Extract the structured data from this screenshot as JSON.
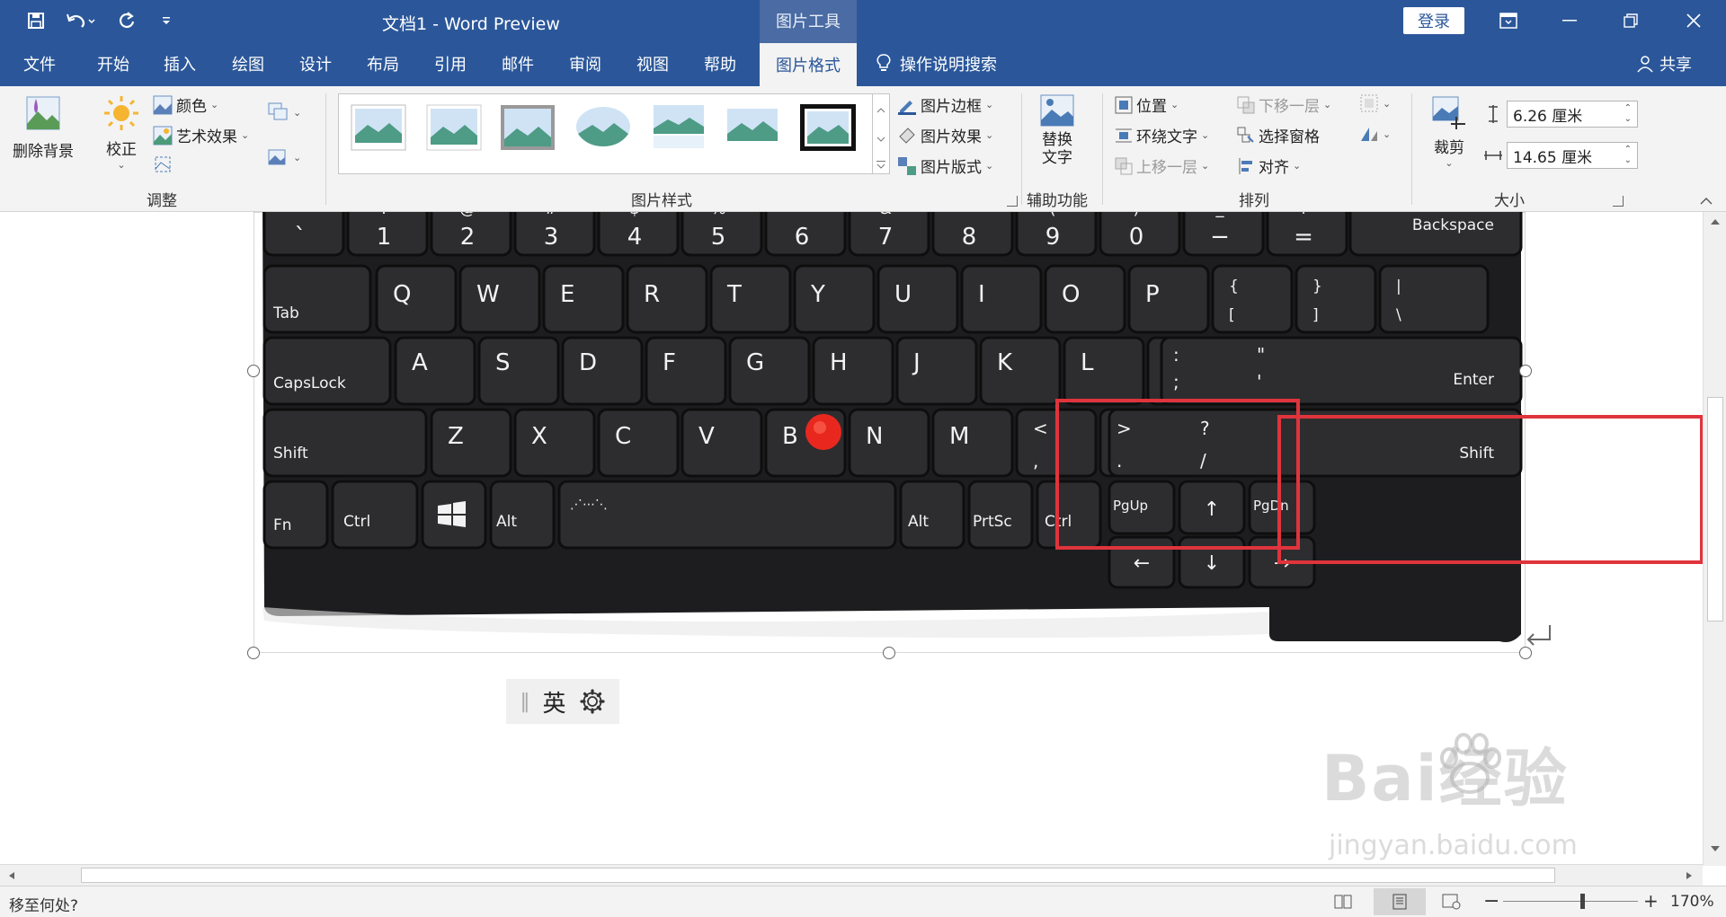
{
  "app": {
    "title": "文档1  -  Word Preview",
    "context_tab_title": "图片工具",
    "login": "登录"
  },
  "tabs": [
    "文件",
    "开始",
    "插入",
    "绘图",
    "设计",
    "布局",
    "引用",
    "邮件",
    "审阅",
    "视图",
    "帮助"
  ],
  "active_tab": "图片格式",
  "search": "操作说明搜索",
  "share": "共享",
  "ribbon": {
    "adjust": {
      "remove_bg": "删除背景",
      "corrections": "校正",
      "color": "颜色",
      "artistic": "艺术效果",
      "label": "调整"
    },
    "styles": {
      "border": "图片边框",
      "effects": "图片效果",
      "layout": "图片版式",
      "label": "图片样式"
    },
    "accessibility": {
      "alt_text": "替换\n文字",
      "label": "辅助功能"
    },
    "arrange": {
      "position": "位置",
      "wrap": "环绕文字",
      "forward": "上移一层",
      "backward": "下移一层",
      "selection_pane": "选择窗格",
      "align": "对齐",
      "label": "排列"
    },
    "size": {
      "crop": "裁剪",
      "height": "6.26 厘米",
      "width": "14.65 厘米",
      "label": "大小"
    }
  },
  "keyboard": {
    "row0": [
      [
        "~",
        "`"
      ],
      [
        "!",
        "1"
      ],
      [
        "@",
        "2"
      ],
      [
        "#",
        "3"
      ],
      [
        "$",
        "4"
      ],
      [
        "%",
        "5"
      ],
      [
        "^",
        "6"
      ],
      [
        "&",
        "7"
      ],
      [
        "*",
        "8"
      ],
      [
        "(",
        "9"
      ],
      [
        ")",
        "0"
      ],
      [
        "_",
        "−"
      ],
      [
        "+",
        "="
      ]
    ],
    "backspace": "Backspace",
    "tab": "Tab",
    "qrow": [
      "Q",
      "W",
      "E",
      "R",
      "T",
      "Y",
      "U",
      "I",
      "O",
      "P"
    ],
    "qrow_sym": [
      [
        "{",
        "["
      ],
      [
        "}",
        "]"
      ],
      [
        "|",
        "\\"
      ]
    ],
    "capslock": "CapsLock",
    "arow": [
      "A",
      "S",
      "D",
      "F",
      "G",
      "H",
      "J",
      "K",
      "L"
    ],
    "arow_sym": [
      [
        ":",
        ";"
      ],
      [
        "\"",
        "'"
      ]
    ],
    "enter": "Enter",
    "shift": "Shift",
    "zrow": [
      "Z",
      "X",
      "C",
      "V",
      "B",
      "N",
      "M"
    ],
    "zrow_sym": [
      [
        "<",
        ","
      ],
      [
        ">",
        "."
      ],
      [
        "?",
        "/"
      ]
    ],
    "fn": "Fn",
    "ctrl": "Ctrl",
    "alt": "Alt",
    "prtsc": "PrtSc",
    "pgup": "PgUp",
    "pgdn": "PgDn",
    "arrows": {
      "up": "↑",
      "left": "←",
      "down": "↓",
      "right": "→"
    }
  },
  "ime": {
    "mode": "英"
  },
  "watermark": {
    "brand": "Bai经验",
    "url": "jingyan.baidu.com"
  },
  "status": {
    "goto": "移至何处?",
    "zoom": "170%"
  },
  "colors": {
    "brand": "#2b579a",
    "highlight": "#e0343c",
    "trackpoint": "#e8281e"
  }
}
